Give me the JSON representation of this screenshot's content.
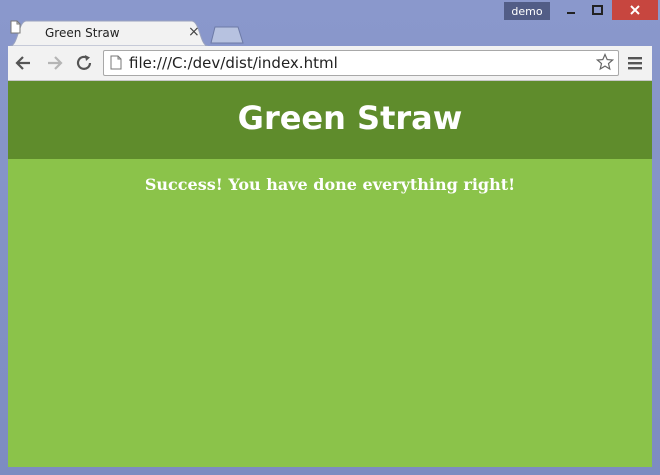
{
  "window": {
    "user_badge": "demo",
    "minimize_glyph": "‒",
    "maximize_glyph": "☐",
    "close_glyph": "✕"
  },
  "tab": {
    "title": "Green Straw",
    "close_glyph": "×"
  },
  "toolbar": {
    "url": "file:///C:/dev/dist/index.html"
  },
  "page": {
    "heading": "Green Straw",
    "message": "Success! You have done everything right!"
  },
  "colors": {
    "header_bg": "#5f8c2c",
    "page_bg": "#8bc34a",
    "window_frame": "#7f8fc4",
    "close_button": "#c7463f"
  }
}
